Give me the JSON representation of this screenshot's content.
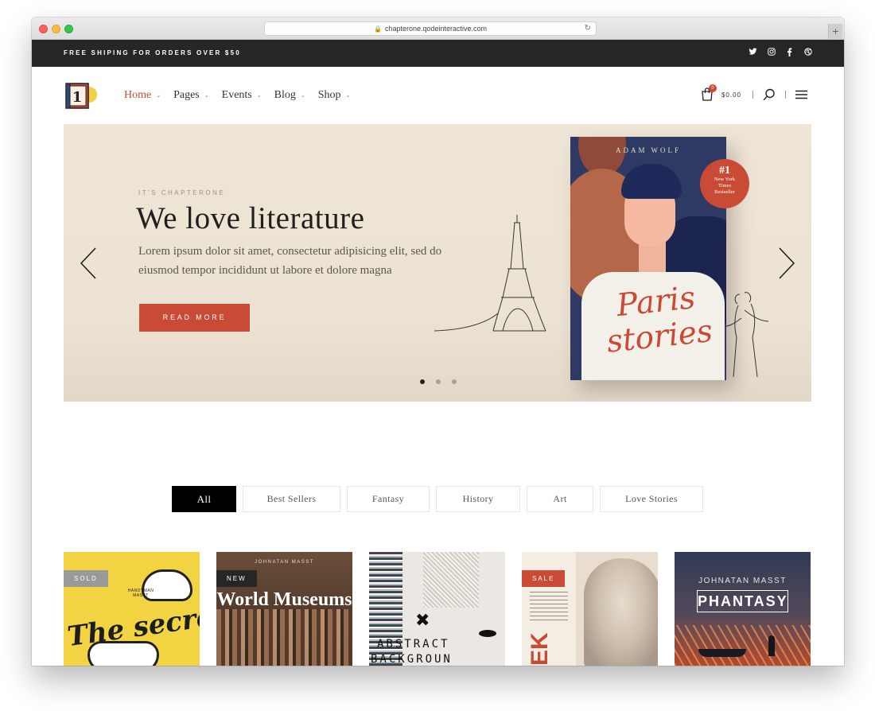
{
  "browser": {
    "url": "chapterone.qodeinteractive.com",
    "new_tab": "+"
  },
  "topbar": {
    "shipping": "FREE SHIPING FOR ORDERS OVER $50",
    "social": [
      "twitter-icon",
      "instagram-icon",
      "facebook-icon",
      "dribbble-icon"
    ]
  },
  "logo": {
    "number": "1"
  },
  "nav": {
    "items": [
      {
        "label": "Home",
        "active": true
      },
      {
        "label": "Pages"
      },
      {
        "label": "Events"
      },
      {
        "label": "Blog"
      },
      {
        "label": "Shop"
      }
    ]
  },
  "cart": {
    "count": "0",
    "total": "$0.00"
  },
  "hero": {
    "eyebrow": "IT'S CHAPTERONE",
    "title": "We love literature",
    "lead": "Lorem ipsum dolor sit amet, consectetur adipisicing elit, sed do eiusmod tempor incididunt ut labore et dolore magna",
    "button": "READ MORE",
    "slides": 3,
    "active_slide": 1,
    "book": {
      "author": "ADAM WOLF",
      "title": "Paris stories",
      "seal_number": "#1",
      "seal_text": [
        "New York",
        "Times",
        "Bestseller"
      ]
    }
  },
  "filters": [
    {
      "label": "All",
      "active": true
    },
    {
      "label": "Best Sellers"
    },
    {
      "label": "Fantasy"
    },
    {
      "label": "History"
    },
    {
      "label": "Art"
    },
    {
      "label": "Love Stories"
    }
  ],
  "products": [
    {
      "tag": "SOLD",
      "tag_color": "#999999",
      "cover_text": "The secrets",
      "cover_brand": "HANDYMAN MASST"
    },
    {
      "tag": "NEW",
      "tag_color": "#262626",
      "author": "JOHNATAN MASST",
      "cover_text": "World Museums"
    },
    {
      "cover_line1": "ABSTRACT",
      "cover_line2": "BACKGROUN"
    },
    {
      "tag": "SALE",
      "tag_color": "#c94a35",
      "cover_text": "EK"
    },
    {
      "author": "JOHNATAN MASST",
      "cover_text": "PHANTASY"
    }
  ],
  "colors": {
    "accent": "#c94a35",
    "topbar": "#262626",
    "hero_bg": "#efe5d6"
  }
}
